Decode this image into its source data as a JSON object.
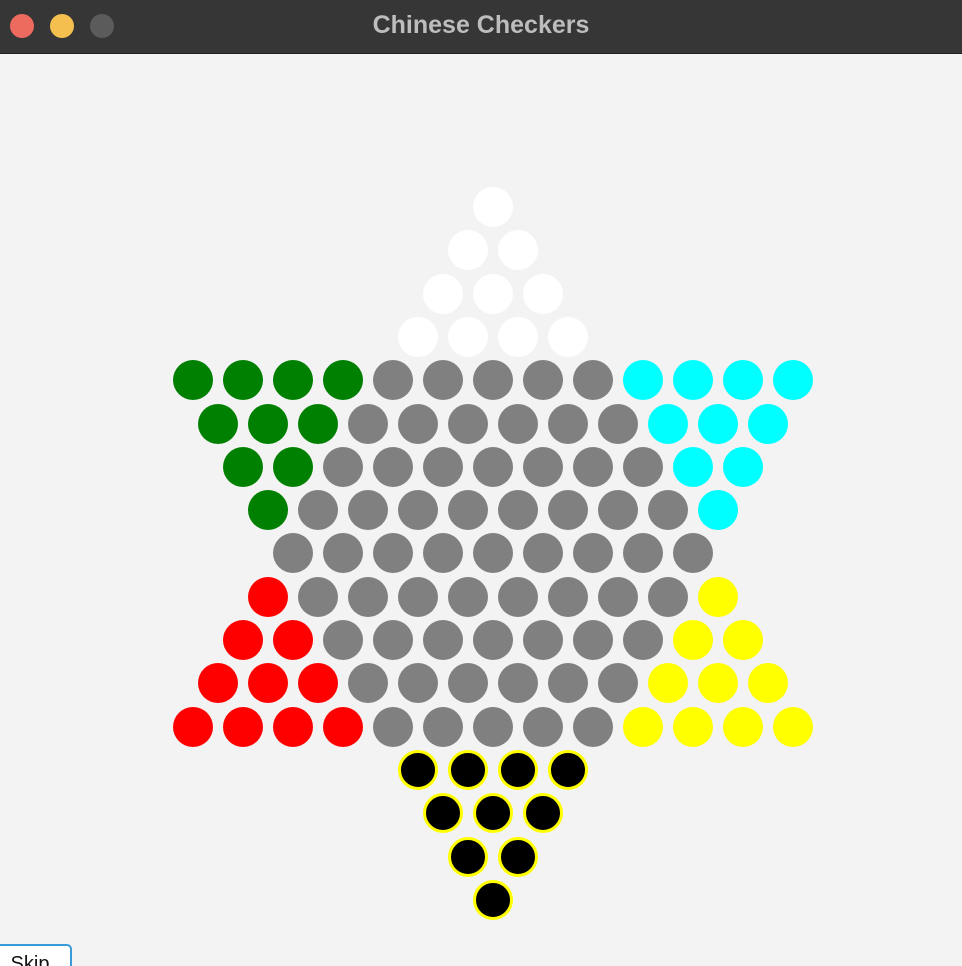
{
  "window": {
    "title": "Chinese Checkers"
  },
  "colors": {
    "titlebar": "#363636",
    "background": "#f3f3f3",
    "empty": "#808080",
    "white": "#ffffff",
    "green": "#008000",
    "cyan": "#00ffff",
    "red": "#ff0000",
    "yellow": "#ffff00",
    "black": "#000000",
    "highlight_ring": "#ffff00"
  },
  "board": {
    "rows": [
      "W",
      "WW",
      "WWW",
      "WWWW",
      "GGGGEEEEECCCC",
      "GGGEEEEEECCC",
      "GGEEEEEEECC",
      "GEEEEEEEEC",
      "EEEEEEEEE",
      "REEEEEEEEY",
      "RREEEEEEEYY",
      "RRREEEEEEYYY",
      "RRRREEEEEYYYY",
      "BBBB",
      "BBB",
      "BB",
      "B"
    ],
    "legend": {
      "W": "white",
      "G": "green",
      "C": "cyan",
      "R": "red",
      "Y": "yellow",
      "B": "black",
      "E": "empty"
    },
    "highlighted_piece": "B"
  },
  "controls": {
    "skip_label": "Skip"
  }
}
